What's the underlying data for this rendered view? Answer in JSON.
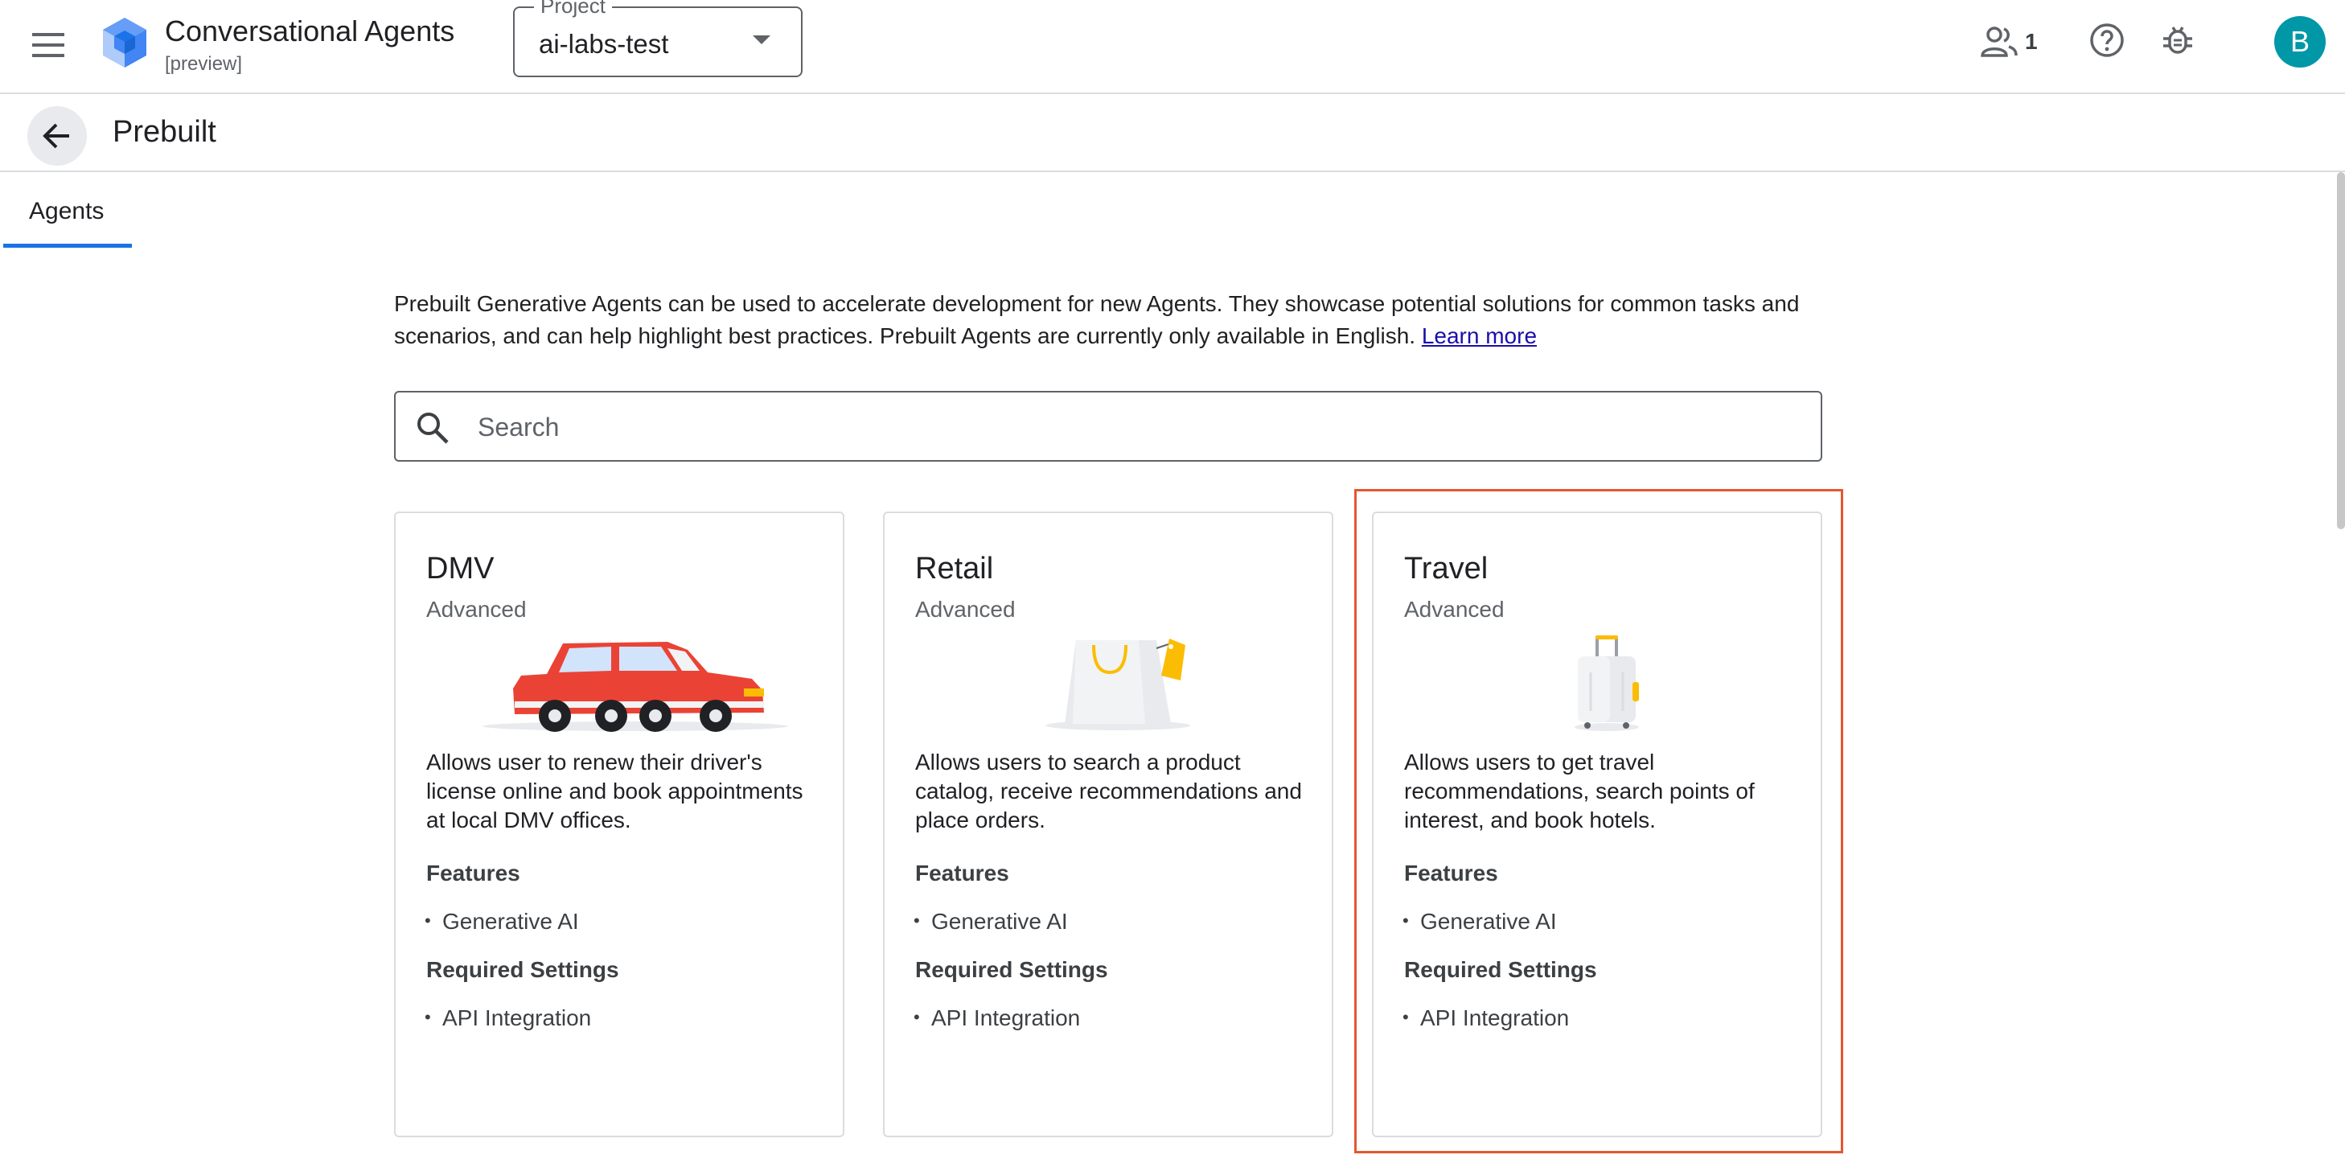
{
  "app": {
    "title": "Conversational Agents",
    "subtitle": "[preview]",
    "project_label": "Project",
    "project_value": "ai-labs-test",
    "people_count": "1",
    "avatar_initial": "B",
    "avatar_color": "#0097a7"
  },
  "page": {
    "title": "Prebuilt",
    "tabs": [
      {
        "label": "Agents",
        "active": true
      }
    ]
  },
  "intro": {
    "text": "Prebuilt Generative Agents can be used to accelerate development for new Agents. They showcase potential solutions for common tasks and scenarios, and can help highlight best practices. Prebuilt Agents are currently only available in English.",
    "link": "Learn more"
  },
  "search": {
    "placeholder": "Search",
    "value": ""
  },
  "cards": [
    {
      "title": "DMV",
      "level": "Advanced",
      "illustration": "red-car",
      "description": "Allows user to renew their driver's license online and book appointments at local DMV offices.",
      "features_heading": "Features",
      "features": [
        "Generative AI"
      ],
      "settings_heading": "Required Settings",
      "settings": [
        "API Integration"
      ]
    },
    {
      "title": "Retail",
      "level": "Advanced",
      "illustration": "shopping-bag",
      "description": "Allows users to search a product catalog, receive recommendations and place orders.",
      "features_heading": "Features",
      "features": [
        "Generative AI"
      ],
      "settings_heading": "Required Settings",
      "settings": [
        "API Integration"
      ]
    },
    {
      "title": "Travel",
      "level": "Advanced",
      "illustration": "suitcase",
      "description": "Allows users to get travel recommendations, search points of interest, and book hotels.",
      "features_heading": "Features",
      "features": [
        "Generative AI"
      ],
      "settings_heading": "Required Settings",
      "settings": [
        "API Integration"
      ],
      "highlighted": true
    }
  ],
  "colors": {
    "accent": "#1a73e8",
    "highlight": "#e4572e",
    "link": "#1a0dab"
  }
}
